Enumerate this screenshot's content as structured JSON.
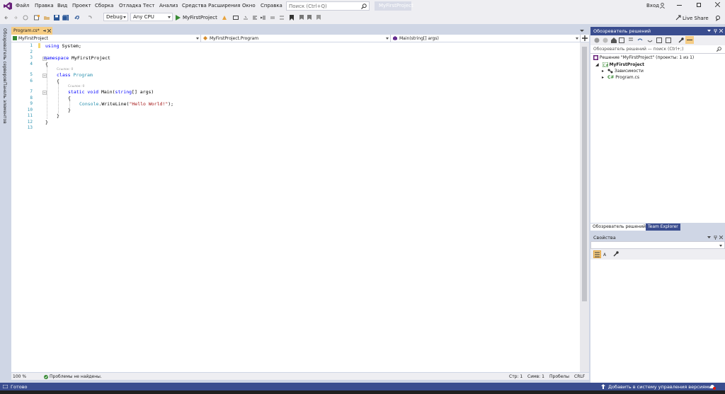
{
  "menu": {
    "items": [
      "Файл",
      "Правка",
      "Вид",
      "Проект",
      "Сборка",
      "Отладка",
      "Тест",
      "Анализ",
      "Средства",
      "Расширения",
      "Окно",
      "Справка"
    ],
    "search_placeholder": "Поиск (Ctrl+Q)",
    "project_name": "MyFirstProject",
    "signin": "Вход",
    "liveshare": "Live Share"
  },
  "toolbar": {
    "config": "Debug",
    "platform": "Any CPU",
    "run_target": "MyFirstProject"
  },
  "left_tabs": [
    "Обозреватель серверов",
    "Панель элементов"
  ],
  "editor": {
    "tab_label": "Program.cs*",
    "nav_project": "MyFirstProject",
    "nav_class": "MyFirstProject.Program",
    "nav_member": "Main(string[] args)",
    "refs": "Ссылок: 0",
    "line_numbers": [
      "1",
      "2",
      "3",
      "4",
      "5",
      "6",
      "7",
      "8",
      "9",
      "10",
      "11",
      "12",
      "13"
    ],
    "lines": [
      {
        "k": "using ",
        "t": "System;"
      },
      {
        "k": "",
        "t": ""
      },
      {
        "k": "namespace ",
        "t": "MyFirstProject"
      },
      {
        "k": "",
        "t": "{"
      },
      {
        "k": "class ",
        "c": "Program"
      },
      {
        "k": "",
        "t": "{"
      },
      {
        "k": "static void ",
        "t": "Main(",
        "k2": "string",
        "t2": "[] args)"
      },
      {
        "k": "",
        "t": "{"
      },
      {
        "c": "Console",
        "t": ".WriteLine(",
        "s": "\"Hello World!\"",
        "t2": ");"
      },
      {
        "k": "",
        "t": "}"
      },
      {
        "k": "",
        "t": "}"
      },
      {
        "k": "",
        "t": "}"
      },
      {
        "k": "",
        "t": ""
      }
    ],
    "zoom": "100 %",
    "issues": "Проблемы не найдены.",
    "line": "Стр: 1",
    "col": "Симв: 1",
    "spaces": "Пробелы",
    "eol": "CRLF"
  },
  "solution_explorer": {
    "title": "Обозреватель решений",
    "search_placeholder": "Обозреватель решений — поиск (Ctrl+;)",
    "solution": "Решение \"MyFirstProject\" (проекты: 1 из 1)",
    "project": "MyFirstProject",
    "deps": "Зависимости",
    "file": "Program.cs",
    "tab_se": "Обозреватель решений",
    "tab_te": "Team Explorer"
  },
  "properties": {
    "title": "Свойства"
  },
  "status": {
    "ready": "Готово",
    "source_control": "Добавить в систему управления версиями",
    "accent": "#3a4d8f"
  }
}
